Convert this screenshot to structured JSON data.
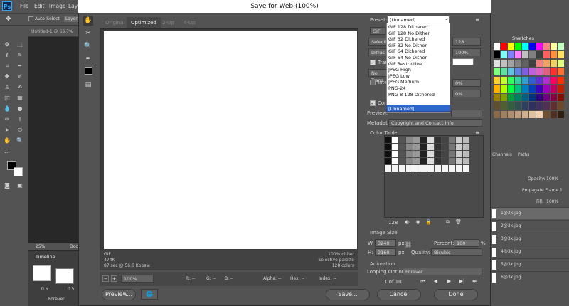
{
  "photoshop": {
    "logo": "Ps",
    "menus": [
      "File",
      "Edit",
      "Image",
      "Layer"
    ],
    "options_bar": {
      "auto_select_label": "Auto-Select",
      "layer_button": "Layer"
    },
    "doc_tab": "Untitled-1 @ 66.7%",
    "status_zoom": "25%",
    "status_doc": "Doc",
    "timeline": {
      "title": "Timeline",
      "frame1_time": "0.5",
      "frame2_time": "0.5",
      "loop": "Forever"
    },
    "swatches_title": "Swatches",
    "swatch_colors": [
      "#ffffff",
      "#ff0000",
      "#ffff00",
      "#00ff00",
      "#00ffff",
      "#0000ff",
      "#ff00ff",
      "#ff8080",
      "#ffffa0",
      "#c0ffc0",
      "#000000",
      "#80ffff",
      "#8080ff",
      "#ff80ff",
      "#c0c0c0",
      "#808080",
      "#404040",
      "#ff6060",
      "#ff9040",
      "#ffe060",
      "#e0e0e0",
      "#c0c0c0",
      "#a0a0a0",
      "#808080",
      "#606060",
      "#404040",
      "#f08080",
      "#f0a060",
      "#f0d060",
      "#e0ff80",
      "#80ff80",
      "#60e0a0",
      "#60c0e0",
      "#6080e0",
      "#8060e0",
      "#c060e0",
      "#e060c0",
      "#e06080",
      "#ff3030",
      "#ff7030",
      "#ffd030",
      "#c0ff30",
      "#30ff60",
      "#30d0a0",
      "#30a0d0",
      "#3060d0",
      "#6030d0",
      "#b030d0",
      "#ff0060",
      "#ff3000",
      "#ffb000",
      "#b0ff00",
      "#00ff40",
      "#00c080",
      "#0080c0",
      "#0040c0",
      "#4000c0",
      "#a000c0",
      "#c00060",
      "#c02000",
      "#a08000",
      "#80a000",
      "#00a040",
      "#008060",
      "#006080",
      "#003080",
      "#300080",
      "#700080",
      "#800040",
      "#801000",
      "#605030",
      "#506030",
      "#306040",
      "#305050",
      "#304060",
      "#303060",
      "#403060",
      "#503050",
      "#603030",
      "#6a4a2a",
      "#8a6a4a",
      "#a08060",
      "#b09070",
      "#c0a080",
      "#d0b090",
      "#e0c0a0",
      "#f0d0b0",
      "#705030",
      "#503020",
      "#302010"
    ],
    "layers": {
      "tab_channels": "Channels",
      "tab_paths": "Paths",
      "opacity_label": "Opacity:",
      "opacity_value": "100%",
      "fill_label": "Fill:",
      "fill_value": "100%",
      "propagate_label": "Propagate Frame 1",
      "items": [
        "1@3x.jpg",
        "2@3x.jpg",
        "3@3x.jpg",
        "4@3x.jpg",
        "5@3x.jpg",
        "6@3x.jpg"
      ]
    }
  },
  "dialog": {
    "title": "Save for Web (100%)",
    "tabs": [
      "Original",
      "Optimized",
      "2-Up",
      "4-Up"
    ],
    "active_tab": "Optimized",
    "info_left": [
      "GIF",
      "474K",
      "87 sec @ 56.6 Kbps"
    ],
    "info_right": [
      "100% dither",
      "Selective palette",
      "128 colors"
    ],
    "zoom": "100%",
    "readout": {
      "r": "R: --",
      "g": "G: --",
      "b": "B: --",
      "alpha": "Alpha: --",
      "hex": "Hex: --",
      "index": "Index: --"
    },
    "preset_label": "Preset:",
    "preset_value": "[Unnamed]",
    "preset_options": [
      "GIF 128 Dithered",
      "GIF 128 No Dither",
      "GIF 32 Dithered",
      "GIF 32 No Dither",
      "GIF 64 Dithered",
      "GIF 64 No Dither",
      "GIF Restrictive",
      "JPEG High",
      "JPEG Low",
      "JPEG Medium",
      "PNG-24",
      "PNG-8 128 Dithered"
    ],
    "preset_selected": "[Unnamed]",
    "format": "GIF",
    "reduction_partial": "Selectiv",
    "colors_value": "128",
    "dither_partial": "Diffusion",
    "dither_value": "100%",
    "transparency_partial": "Trans",
    "matte_partial": "No Trans",
    "interlaced_partial": "Inter",
    "lossy_value": "0%",
    "websnap_value": "0%",
    "convert_partial": "Conv",
    "preview_label": "Preview:",
    "metadata_label": "Metadata:",
    "metadata_value": "Copyright and Contact Info",
    "color_table_title": "Color Table",
    "color_table_count": "128",
    "image_size_title": "Image Size",
    "width_label": "W:",
    "width_value": "3240",
    "height_label": "H:",
    "height_value": "2160",
    "unit": "px",
    "percent_label": "Percent:",
    "percent_value": "100",
    "percent_unit": "%",
    "quality_label": "Quality:",
    "quality_value": "Bicubic",
    "animation_title": "Animation",
    "looping_label": "Looping Options:",
    "looping_value": "Forever",
    "frame_counter": "1 of 10",
    "buttons": {
      "preview": "Preview...",
      "save": "Save...",
      "cancel": "Cancel",
      "done": "Done"
    }
  }
}
